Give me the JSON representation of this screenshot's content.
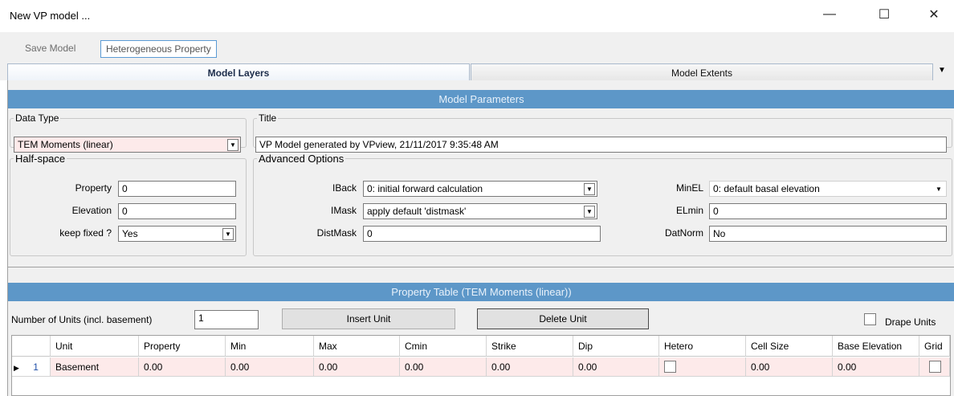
{
  "window": {
    "title": "New VP model ...",
    "minimize": "—",
    "maximize": "☐",
    "close": "✕"
  },
  "toolbar": {
    "save_label": "Save Model",
    "hetero_label": "Heterogeneous Property"
  },
  "tabs": [
    {
      "label": "Model Layers",
      "active": true
    },
    {
      "label": "Model Extents",
      "active": false
    }
  ],
  "tab_overflow": "▼",
  "model_parameters": {
    "header": "Model Parameters",
    "data_type": {
      "legend": "Data Type",
      "value": "TEM Moments (linear)"
    },
    "title": {
      "legend": "Title",
      "value": "VP Model generated by VPview, 21/11/2017 9:35:48 AM"
    },
    "half_space": {
      "legend": "Half-space",
      "property_label": "Property",
      "property_value": "0",
      "elevation_label": "Elevation",
      "elevation_value": "0",
      "keep_fixed_label": "keep fixed ?",
      "keep_fixed_value": "Yes"
    },
    "advanced": {
      "legend": "Advanced Options",
      "iback_label": "IBack",
      "iback_value": "0: initial forward calculation",
      "imask_label": "IMask",
      "imask_value": "apply default 'distmask'",
      "distmask_label": "DistMask",
      "distmask_value": "0",
      "minel_label": "MinEL",
      "minel_value": "0: default basal elevation",
      "elmin_label": "ELmin",
      "elmin_value": "0",
      "datnorm_label": "DatNorm",
      "datnorm_value": "No"
    }
  },
  "property_table": {
    "header": "Property Table (TEM Moments (linear))",
    "num_units_label": "Number of Units (incl. basement)",
    "num_units_value": "1",
    "insert_label": "Insert Unit",
    "delete_label": "Delete Unit",
    "drape_label": "Drape Units",
    "columns": [
      "Unit",
      "Property",
      "Min",
      "Max",
      "Cmin",
      "Strike",
      "Dip",
      "Hetero",
      "Cell Size",
      "Base Elevation",
      "Grid"
    ],
    "rows": [
      {
        "index": "1",
        "unit": "Basement",
        "property": "0.00",
        "min": "0.00",
        "max": "0.00",
        "cmin": "0.00",
        "strike": "0.00",
        "dip": "0.00",
        "cell_size": "0.00",
        "base_elevation": "0.00"
      }
    ]
  }
}
